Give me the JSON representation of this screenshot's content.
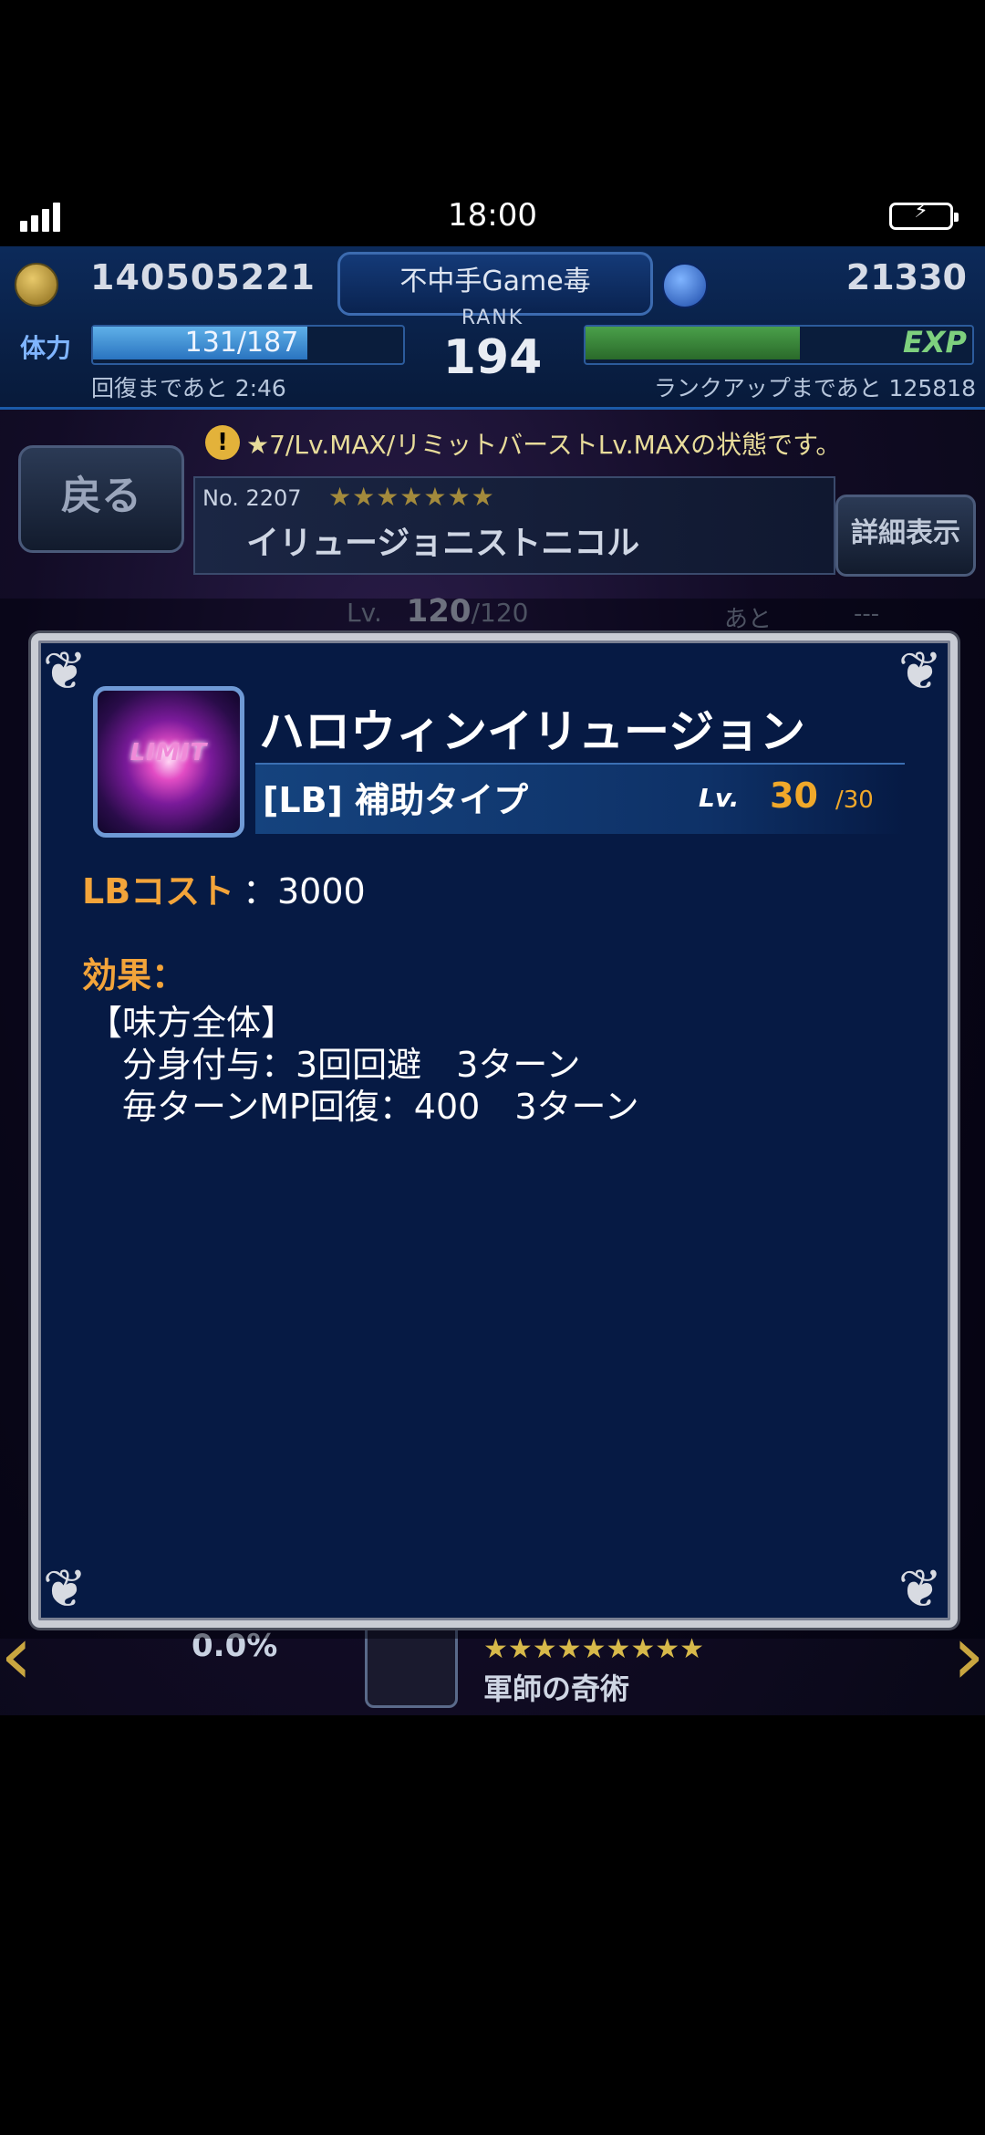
{
  "status": {
    "time": "18:00"
  },
  "header": {
    "coins": "140505221",
    "player_name": "不中手Game毒",
    "gems": "21330",
    "stamina_label": "体力",
    "stamina": "131/187",
    "stamina_fill": 0.7,
    "stamina_note": "回復まであと 2:46",
    "rank_label": "RANK",
    "rank": "194",
    "exp_label": "EXP",
    "exp_fill": 0.56,
    "exp_note": "ランクアップまであと 125818"
  },
  "unit": {
    "warning": "★7/Lv.MAX/リミットバーストLv.MAXの状態です。",
    "back_label": "戻る",
    "number": "No. 2207",
    "stars": "★★★★★★★",
    "name": "イリュージョニストニコル",
    "detail_label": "詳細表示",
    "lv_label": "Lv.",
    "lv_cur": "120",
    "lv_max": "/120",
    "next_label": "あと",
    "next_val": "---"
  },
  "background": {
    "percent": "0.0%",
    "card_stars": "★★★★★★★★★",
    "card_name": "軍師の奇術"
  },
  "modal": {
    "icon_text": "LIMIT",
    "skill_name": "ハロウィンイリュージョン",
    "skill_type": "[LB] 補助タイプ",
    "lv_tag": "Lv.",
    "lv_cur": "30",
    "lv_max": "/30",
    "cost_label": "LBコスト",
    "cost_value": "：3000",
    "effect_label": "効果：",
    "effect_lines": [
      "【味方全体】",
      "　分身付与：3回回避　3ターン",
      "　毎ターンMP回復：400　3ターン"
    ]
  }
}
